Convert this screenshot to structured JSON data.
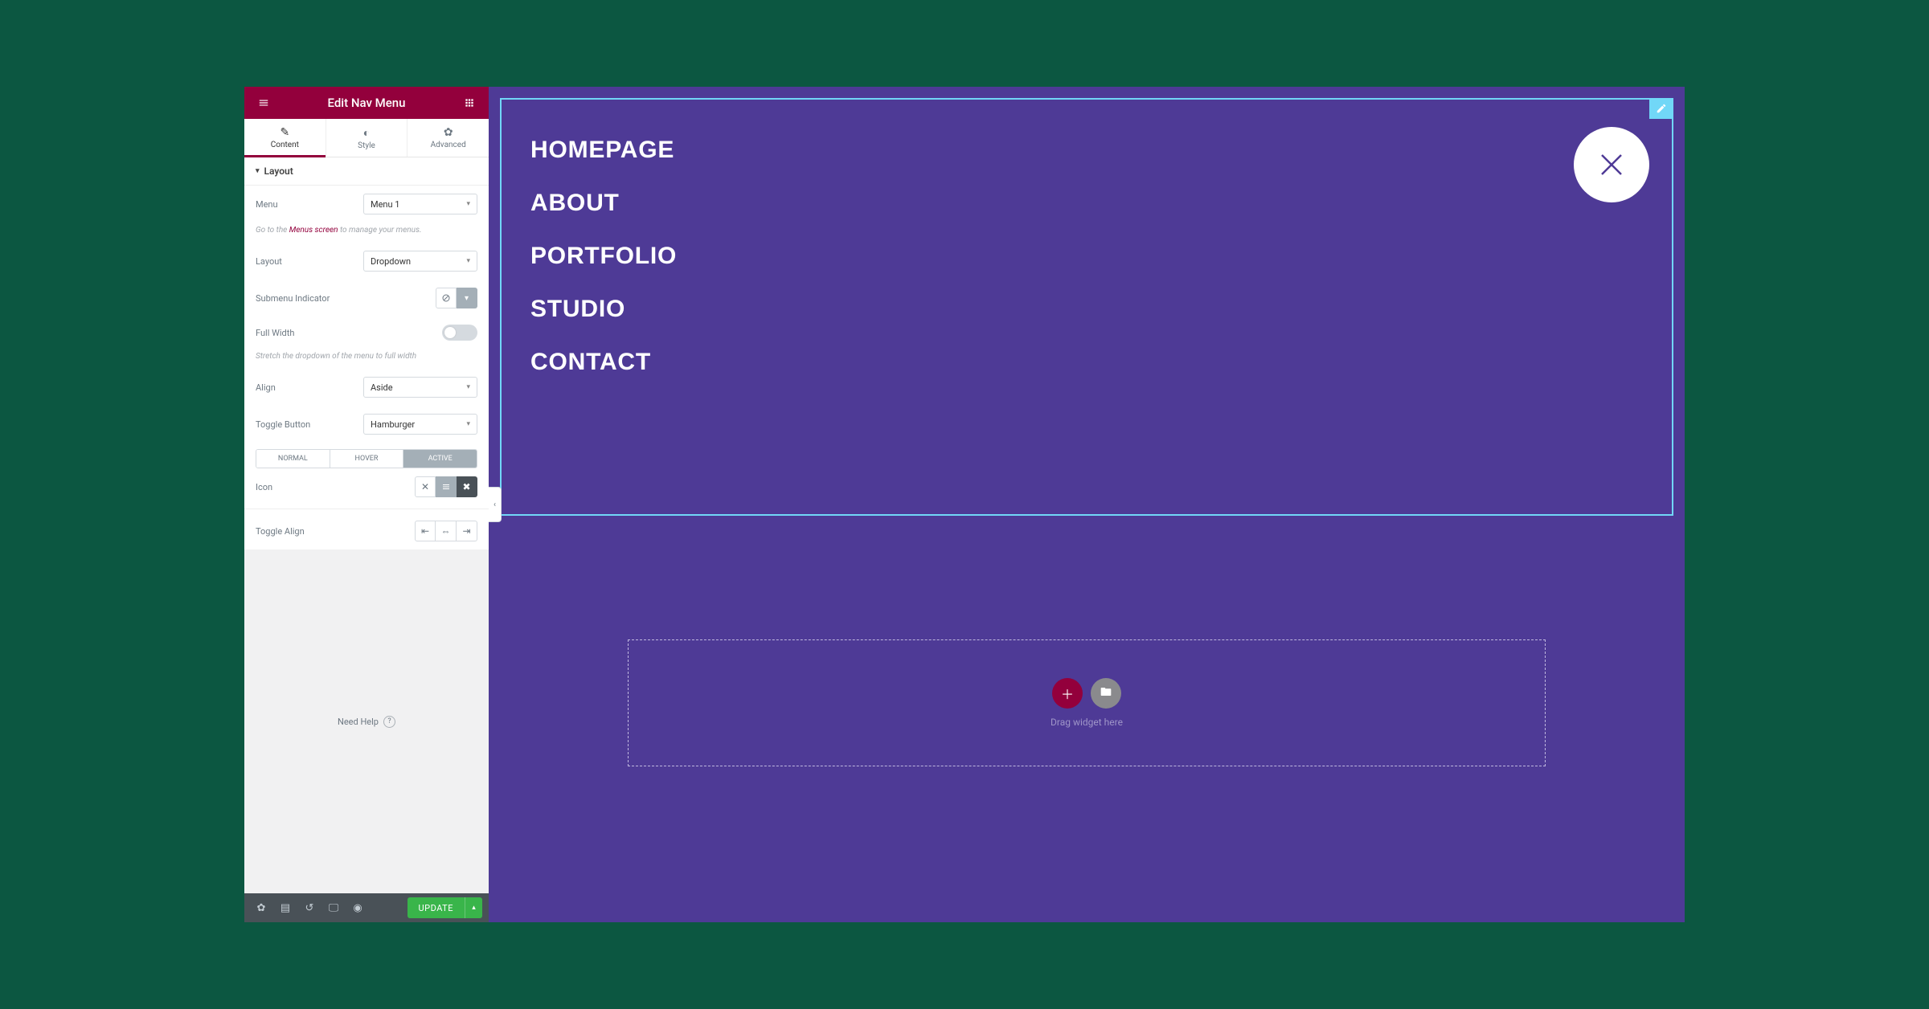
{
  "panel": {
    "title": "Edit Nav Menu",
    "tabs": {
      "content": "Content",
      "style": "Style",
      "advanced": "Advanced"
    },
    "section": "Layout",
    "fields": {
      "menu_label": "Menu",
      "menu_value": "Menu 1",
      "menu_hint_prefix": "Go to the ",
      "menu_hint_link": "Menus screen",
      "menu_hint_suffix": " to manage your menus.",
      "layout_label": "Layout",
      "layout_value": "Dropdown",
      "submenu_label": "Submenu Indicator",
      "fullwidth_label": "Full Width",
      "fullwidth_hint": "Stretch the dropdown of the menu to full width",
      "align_label": "Align",
      "align_value": "Aside",
      "toggle_label": "Toggle Button",
      "toggle_value": "Hamburger",
      "state_normal": "NORMAL",
      "state_hover": "HOVER",
      "state_active": "ACTIVE",
      "icon_label": "Icon",
      "togglealign_label": "Toggle Align"
    },
    "help": "Need Help",
    "footer": {
      "update": "UPDATE"
    }
  },
  "preview": {
    "menu_items": [
      "HOMEPAGE",
      "ABOUT",
      "PORTFOLIO",
      "STUDIO",
      "CONTACT"
    ],
    "dropzone_text": "Drag widget here"
  }
}
